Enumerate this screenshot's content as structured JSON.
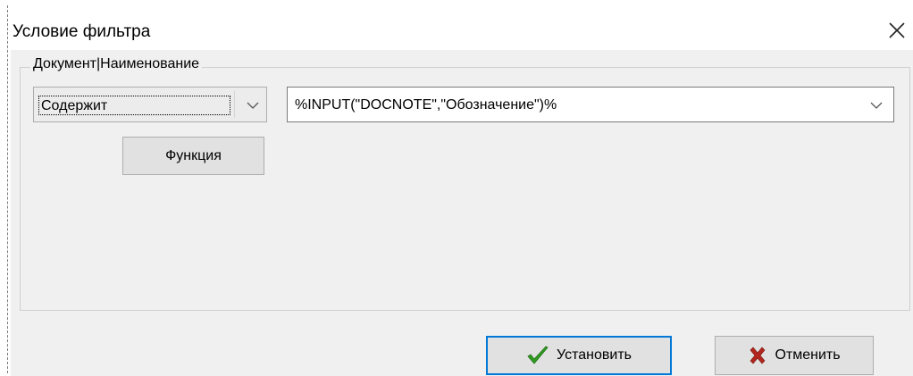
{
  "window": {
    "title": "Условие фильтра",
    "close_icon": "close-icon"
  },
  "filter": {
    "field_label": "Документ|Наименование",
    "operator": {
      "value": "Содержит",
      "icon": "chevron-down-icon"
    },
    "value": {
      "text": "%INPUT(\"DOCNOTE\",\"Обозначение\")%",
      "icon": "chevron-down-icon"
    },
    "function_button_label": "Функция"
  },
  "footer": {
    "apply": {
      "label": "Установить",
      "icon": "checkmark-icon",
      "icon_color": "#2e9e1f"
    },
    "cancel": {
      "label": "Отменить",
      "icon": "cross-icon",
      "icon_color": "#b3261e"
    }
  },
  "colors": {
    "focus_border": "#0078d7",
    "dialog_background": "#f0f0f0"
  }
}
